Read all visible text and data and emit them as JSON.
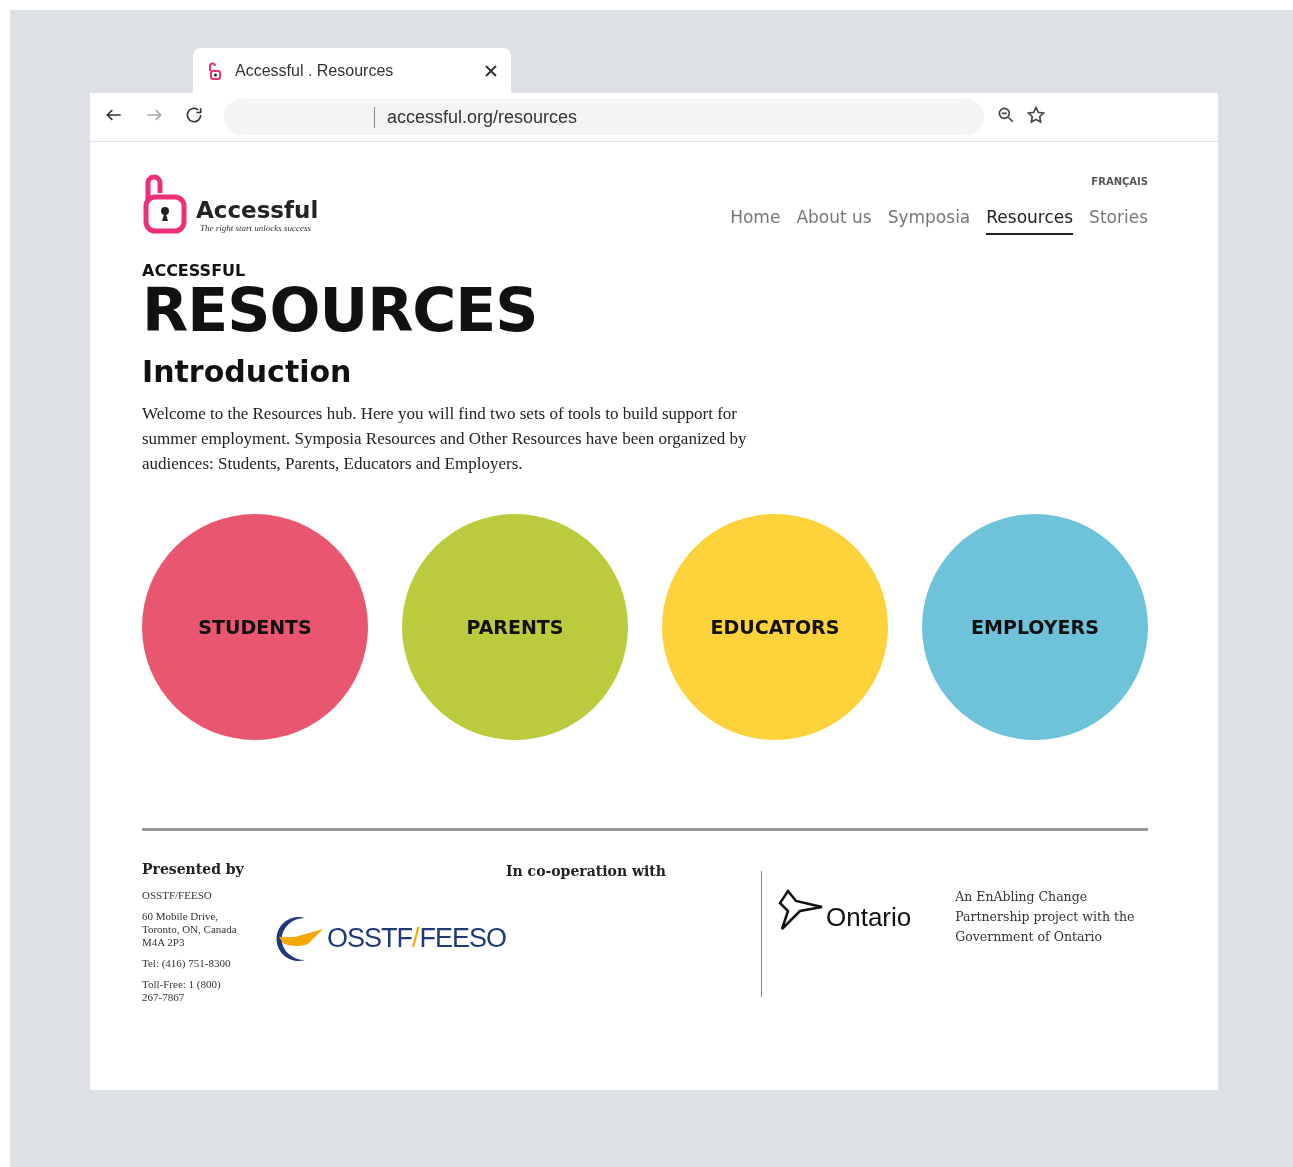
{
  "browser": {
    "tab_title": "Accessful . Resources",
    "url": "accessful.org/resources"
  },
  "logo": {
    "name": "Accessful",
    "tagline": "The right start unlocks success"
  },
  "language_link": "FRANÇAIS",
  "nav": [
    {
      "label": "Home",
      "selected": false
    },
    {
      "label": "About us",
      "selected": false
    },
    {
      "label": "Symposia",
      "selected": false
    },
    {
      "label": "Resources",
      "selected": true
    },
    {
      "label": "Stories",
      "selected": false
    }
  ],
  "kicker": "ACCESSFUL",
  "title": "RESOURCES",
  "subtitle": "Introduction",
  "intro": "Welcome to the Resources hub. Here you will find two sets of tools to build support for summer employment. Symposia Resources and Other Resources have been organized by audiences: Students, Parents, Educators and Employers.",
  "audiences": [
    {
      "label": "STUDENTS",
      "color": "#e8566f"
    },
    {
      "label": "PARENTS",
      "color": "#bccb3e"
    },
    {
      "label": "EDUCATORS",
      "color": "#fdd23a"
    },
    {
      "label": "EMPLOYERS",
      "color": "#6ec2d9"
    }
  ],
  "footer": {
    "presented_heading": "Presented by",
    "org": "OSSTF/FEESO",
    "address": [
      "60 Mobile Drive,",
      "Toronto, ON, Canada",
      "M4A 2P3"
    ],
    "phone": "Tel: (416) 751-8300",
    "toll_free": [
      "Toll-Free: 1 (800)",
      "267-7867"
    ],
    "osstf_logo": {
      "left": "OSSTF",
      "slash": "/",
      "right": "FEESO"
    },
    "cooperation_heading": "In co-operation with",
    "ontario_logo": "Ontario",
    "partner_note": "An EnAbling Change Partnership project with the Government of Ontario"
  }
}
